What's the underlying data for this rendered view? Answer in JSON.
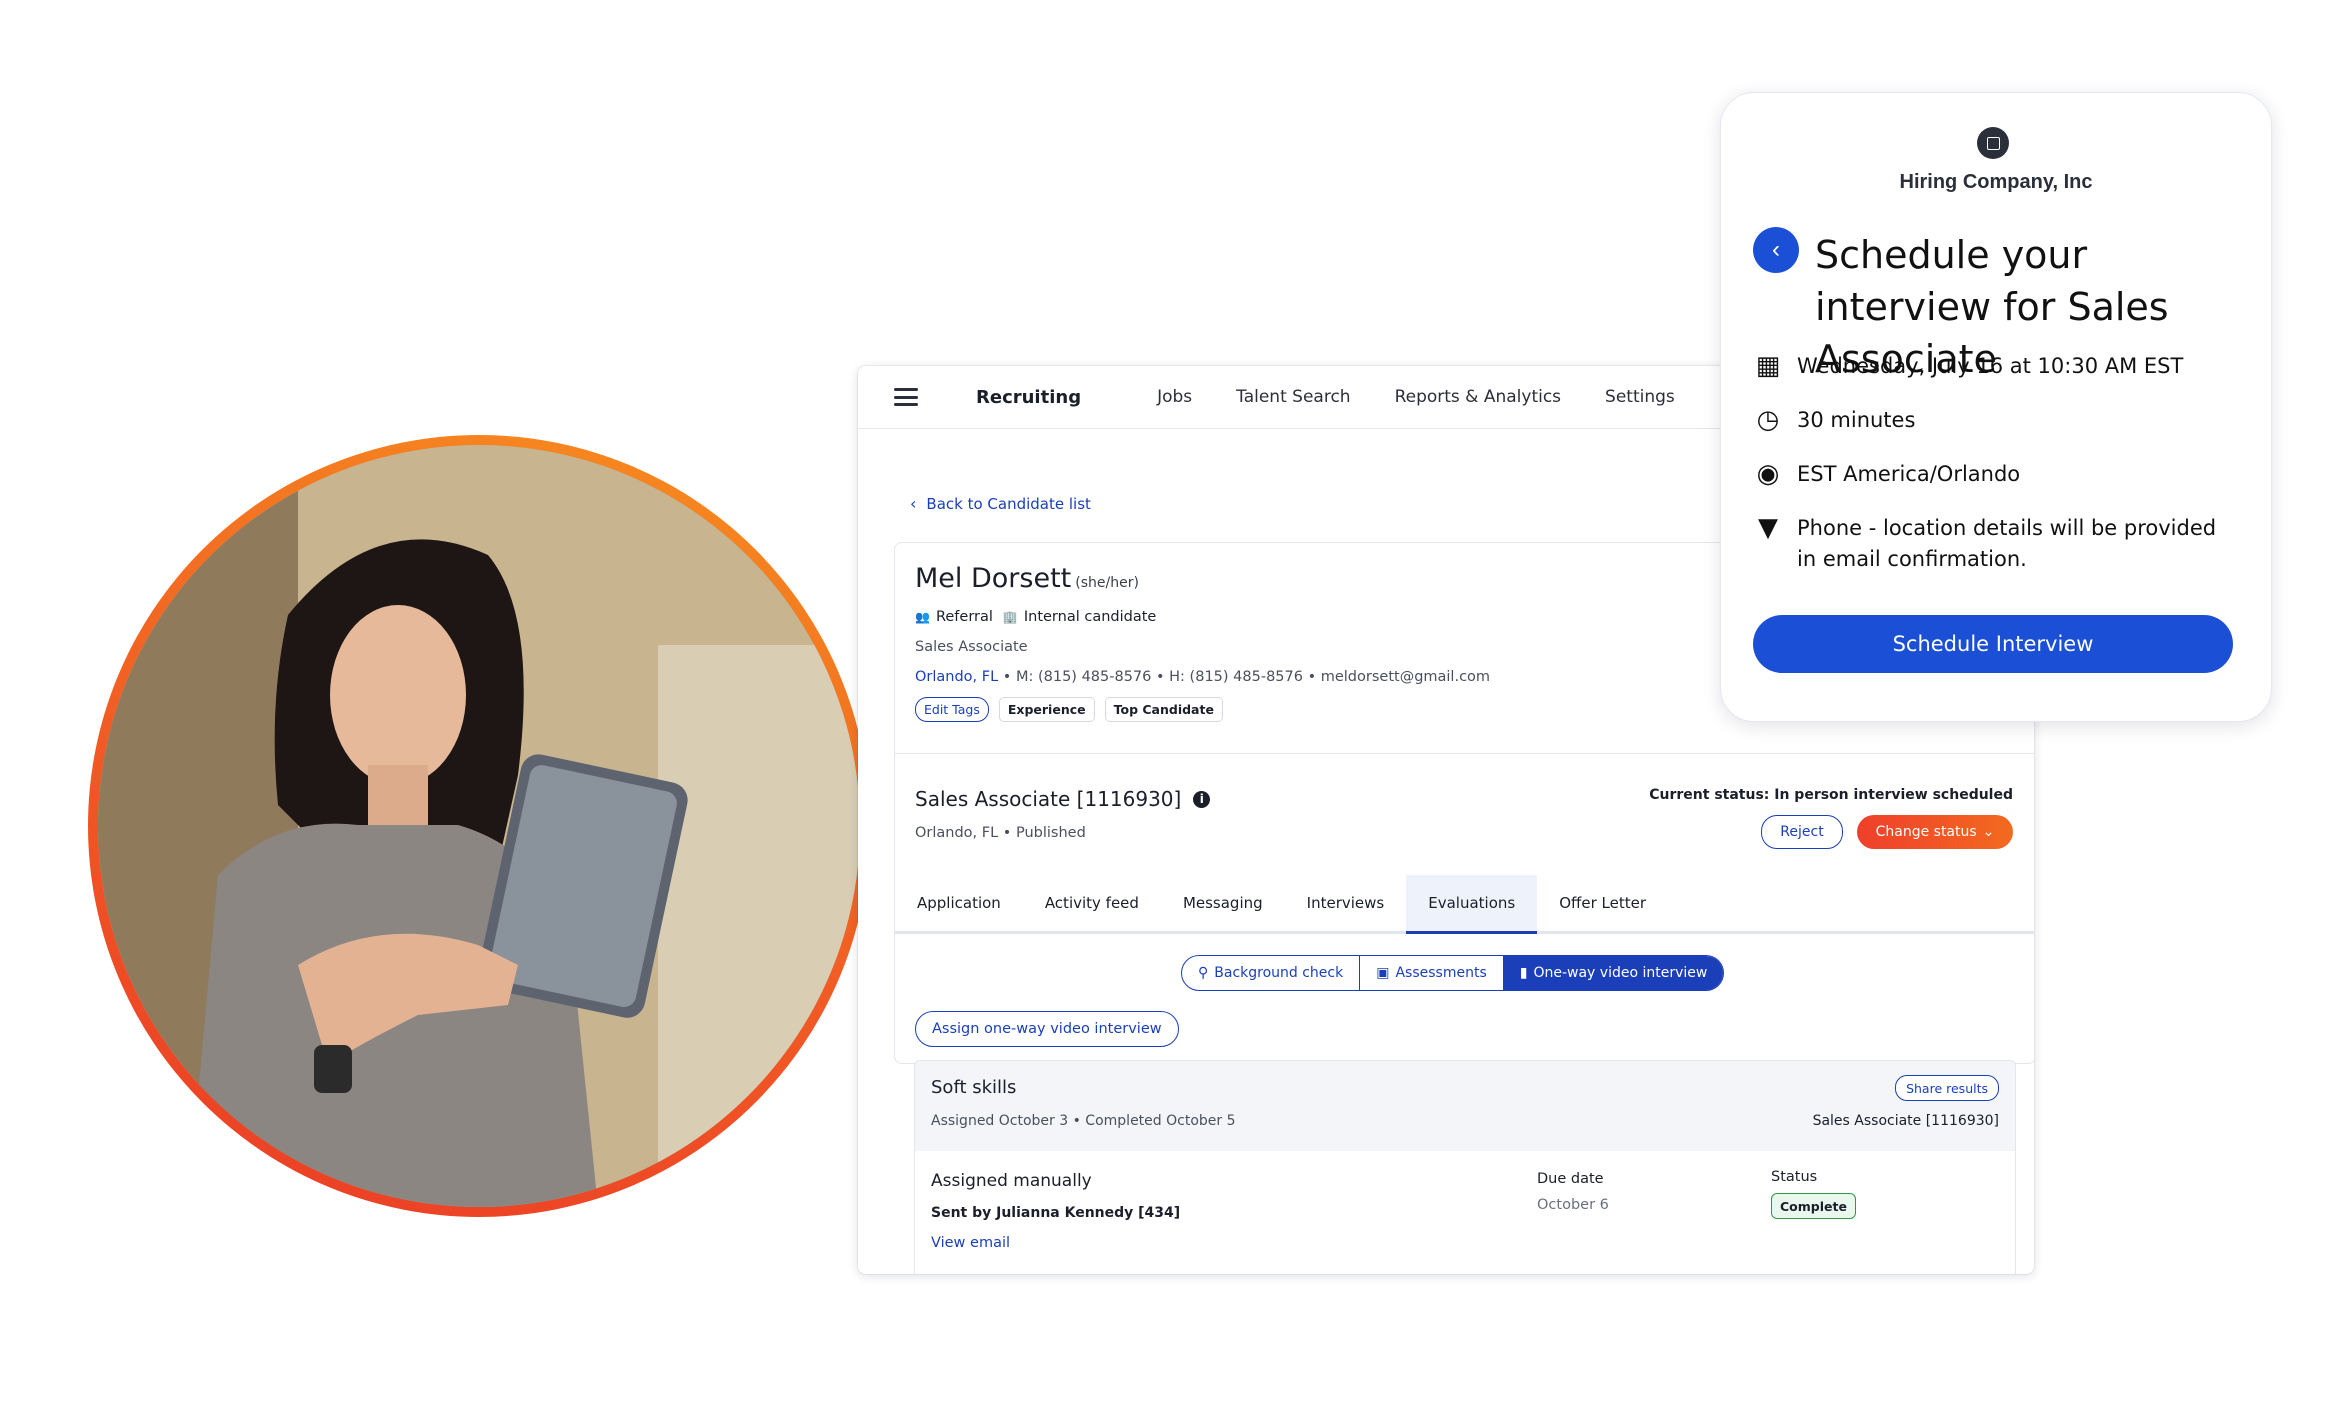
{
  "photo": {
    "alt_desc": ""
  },
  "app": {
    "brand": "Recruiting",
    "nav": [
      "Jobs",
      "Talent Search",
      "Reports & Analytics",
      "Settings"
    ],
    "back_link": "Back to Candidate list"
  },
  "candidate": {
    "name": "Mel Dorsett",
    "pronouns": "(she/her)",
    "referral": "Referral",
    "internal": "Internal candidate",
    "role": "Sales Associate",
    "location": "Orlando, FL",
    "contact": " • M: (815) 485-8576 • H: (815) 485-8576 • meldorsett@gmail.com",
    "tags": {
      "edit": "Edit Tags",
      "t1": "Experience",
      "t2": "Top Candidate"
    }
  },
  "job": {
    "title": "Sales Associate [1116930]",
    "info_icon": "i",
    "sub": "Orlando, FL • Published",
    "current_status": "Current status: In person interview scheduled",
    "reject": "Reject",
    "change_status": "Change status"
  },
  "tabs": [
    "Application",
    "Activity feed",
    "Messaging",
    "Interviews",
    "Evaluations",
    "Offer Letter"
  ],
  "segments": [
    "Background check",
    "Assessments",
    "One-way video interview"
  ],
  "assign_button": "Assign one-way video interview",
  "evaluation": {
    "title": "Soft skills",
    "dates": "Assigned October 3 • Completed October 5",
    "share": "Share results",
    "ref": "Sales Associate [1116930]",
    "assigned": "Assigned manually",
    "sent_by": "Sent by Julianna Kennedy [434]",
    "view_email": "View email",
    "due_label": "Due date",
    "due_value": "October 6",
    "status_label": "Status",
    "status_value": "Complete"
  },
  "popup": {
    "company": "Hiring Company, Inc",
    "title": "Schedule your interview for Sales Associate",
    "datetime": "Wednesday, July 16 at 10:30 AM EST",
    "duration": "30 minutes",
    "timezone": "EST America/Orlando",
    "location": "Phone - location details will be provided in email confirmation.",
    "button": "Schedule Interview"
  },
  "colors": {
    "accent": "#1a3fb8",
    "popup_blue": "#1a4fd6",
    "orange": "#f36a1f",
    "red": "#ef3f2c"
  }
}
